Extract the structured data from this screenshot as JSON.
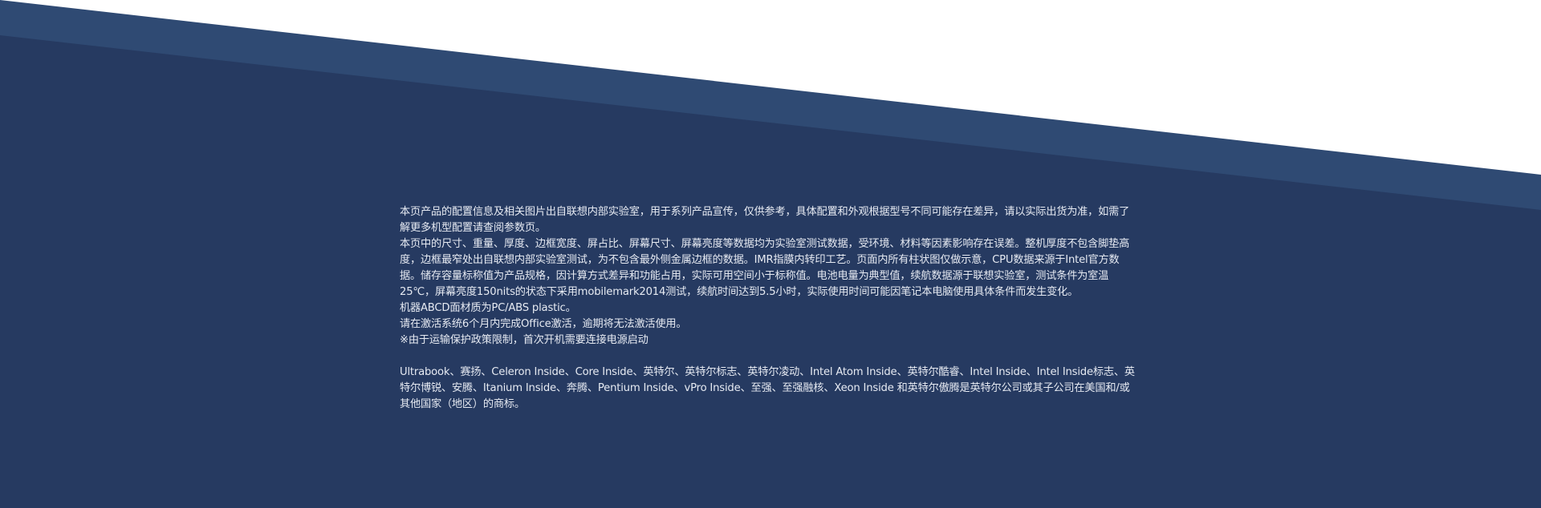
{
  "colors": {
    "background_main": "#263a61",
    "background_stripe": "#2f4a73",
    "page_white": "#ffffff",
    "text": "#e6eaf2"
  },
  "disclaimer": {
    "paragraphs": [
      "本页产品的配置信息及相关图片出自联想内部实验室，用于系列产品宣传，仅供参考，具体配置和外观根据型号不同可能存在差异，请以实际出货为准，如需了解更多机型配置请查阅参数页。",
      "本页中的尺寸、重量、厚度、边框宽度、屏占比、屏幕尺寸、屏幕亮度等数据均为实验室测试数据，受环境、材料等因素影响存在误差。整机厚度不包含脚垫高度，边框最窄处出自联想内部实验室测试，为不包含最外侧金属边框的数据。IMR指膜内转印工艺。页面内所有柱状图仅做示意，CPU数据来源于Intel官方数据。储存容量标称值为产品规格，因计算方式差异和功能占用，实际可用空间小于标称值。电池电量为典型值，续航数据源于联想实验室，测试条件为室温25℃，屏幕亮度150nits的状态下采用mobilemark2014测试，续航时间达到5.5小时，实际使用时间可能因笔记本电脑使用具体条件而发生变化。",
      "机器ABCD面材质为PC/ABS plastic。",
      "请在激活系统6个月内完成Office激活，逾期将无法激活使用。",
      "※由于运输保护政策限制，首次开机需要连接电源启动"
    ],
    "trademark": "Ultrabook、赛扬、Celeron Inside、Core Inside、英特尔、英特尔标志、英特尔凌动、Intel Atom Inside、英特尔酷睿、Intel Inside、Intel Inside标志、英特尔博锐、安腾、Itanium Inside、奔腾、Pentium Inside、vPro Inside、至强、至强融核、Xeon Inside 和英特尔傲腾是英特尔公司或其子公司在美国和/或其他国家（地区）的商标。"
  }
}
